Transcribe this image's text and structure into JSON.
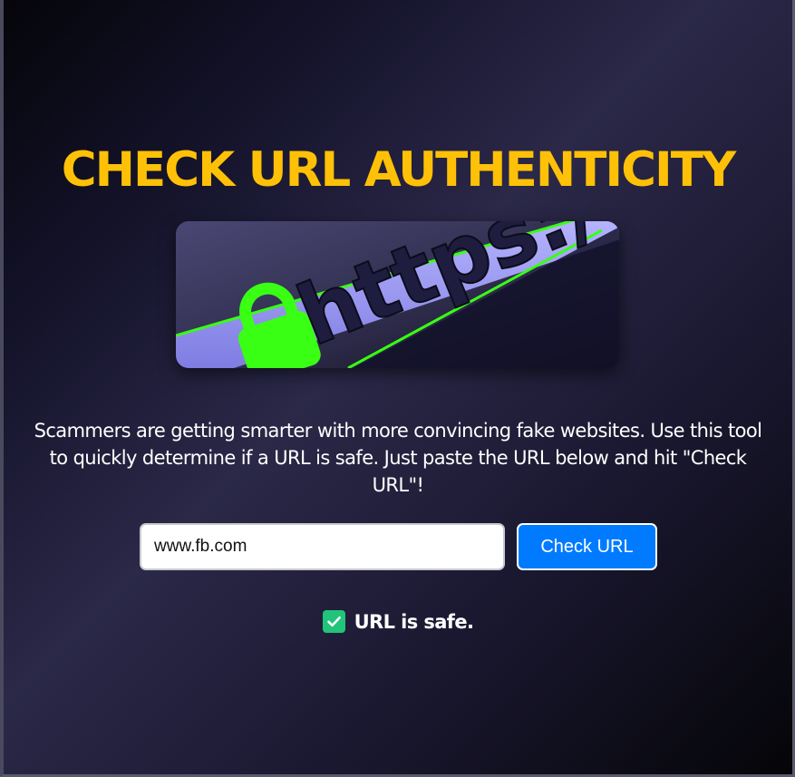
{
  "header": {
    "title": "CHECK URL AUTHENTICITY"
  },
  "banner": {
    "text": "https:/"
  },
  "description": {
    "text": "Scammers are getting smarter with more convincing fake websites. Use this tool to quickly determine if a URL is safe. Just paste the URL below and hit \"Check URL\"!"
  },
  "form": {
    "url_value": "www.fb.com",
    "button_label": "Check URL"
  },
  "result": {
    "icon": "check-icon",
    "text": "URL is safe.",
    "status_color": "#21c47a"
  },
  "colors": {
    "accent": "#ffc107",
    "button": "#007bff"
  }
}
